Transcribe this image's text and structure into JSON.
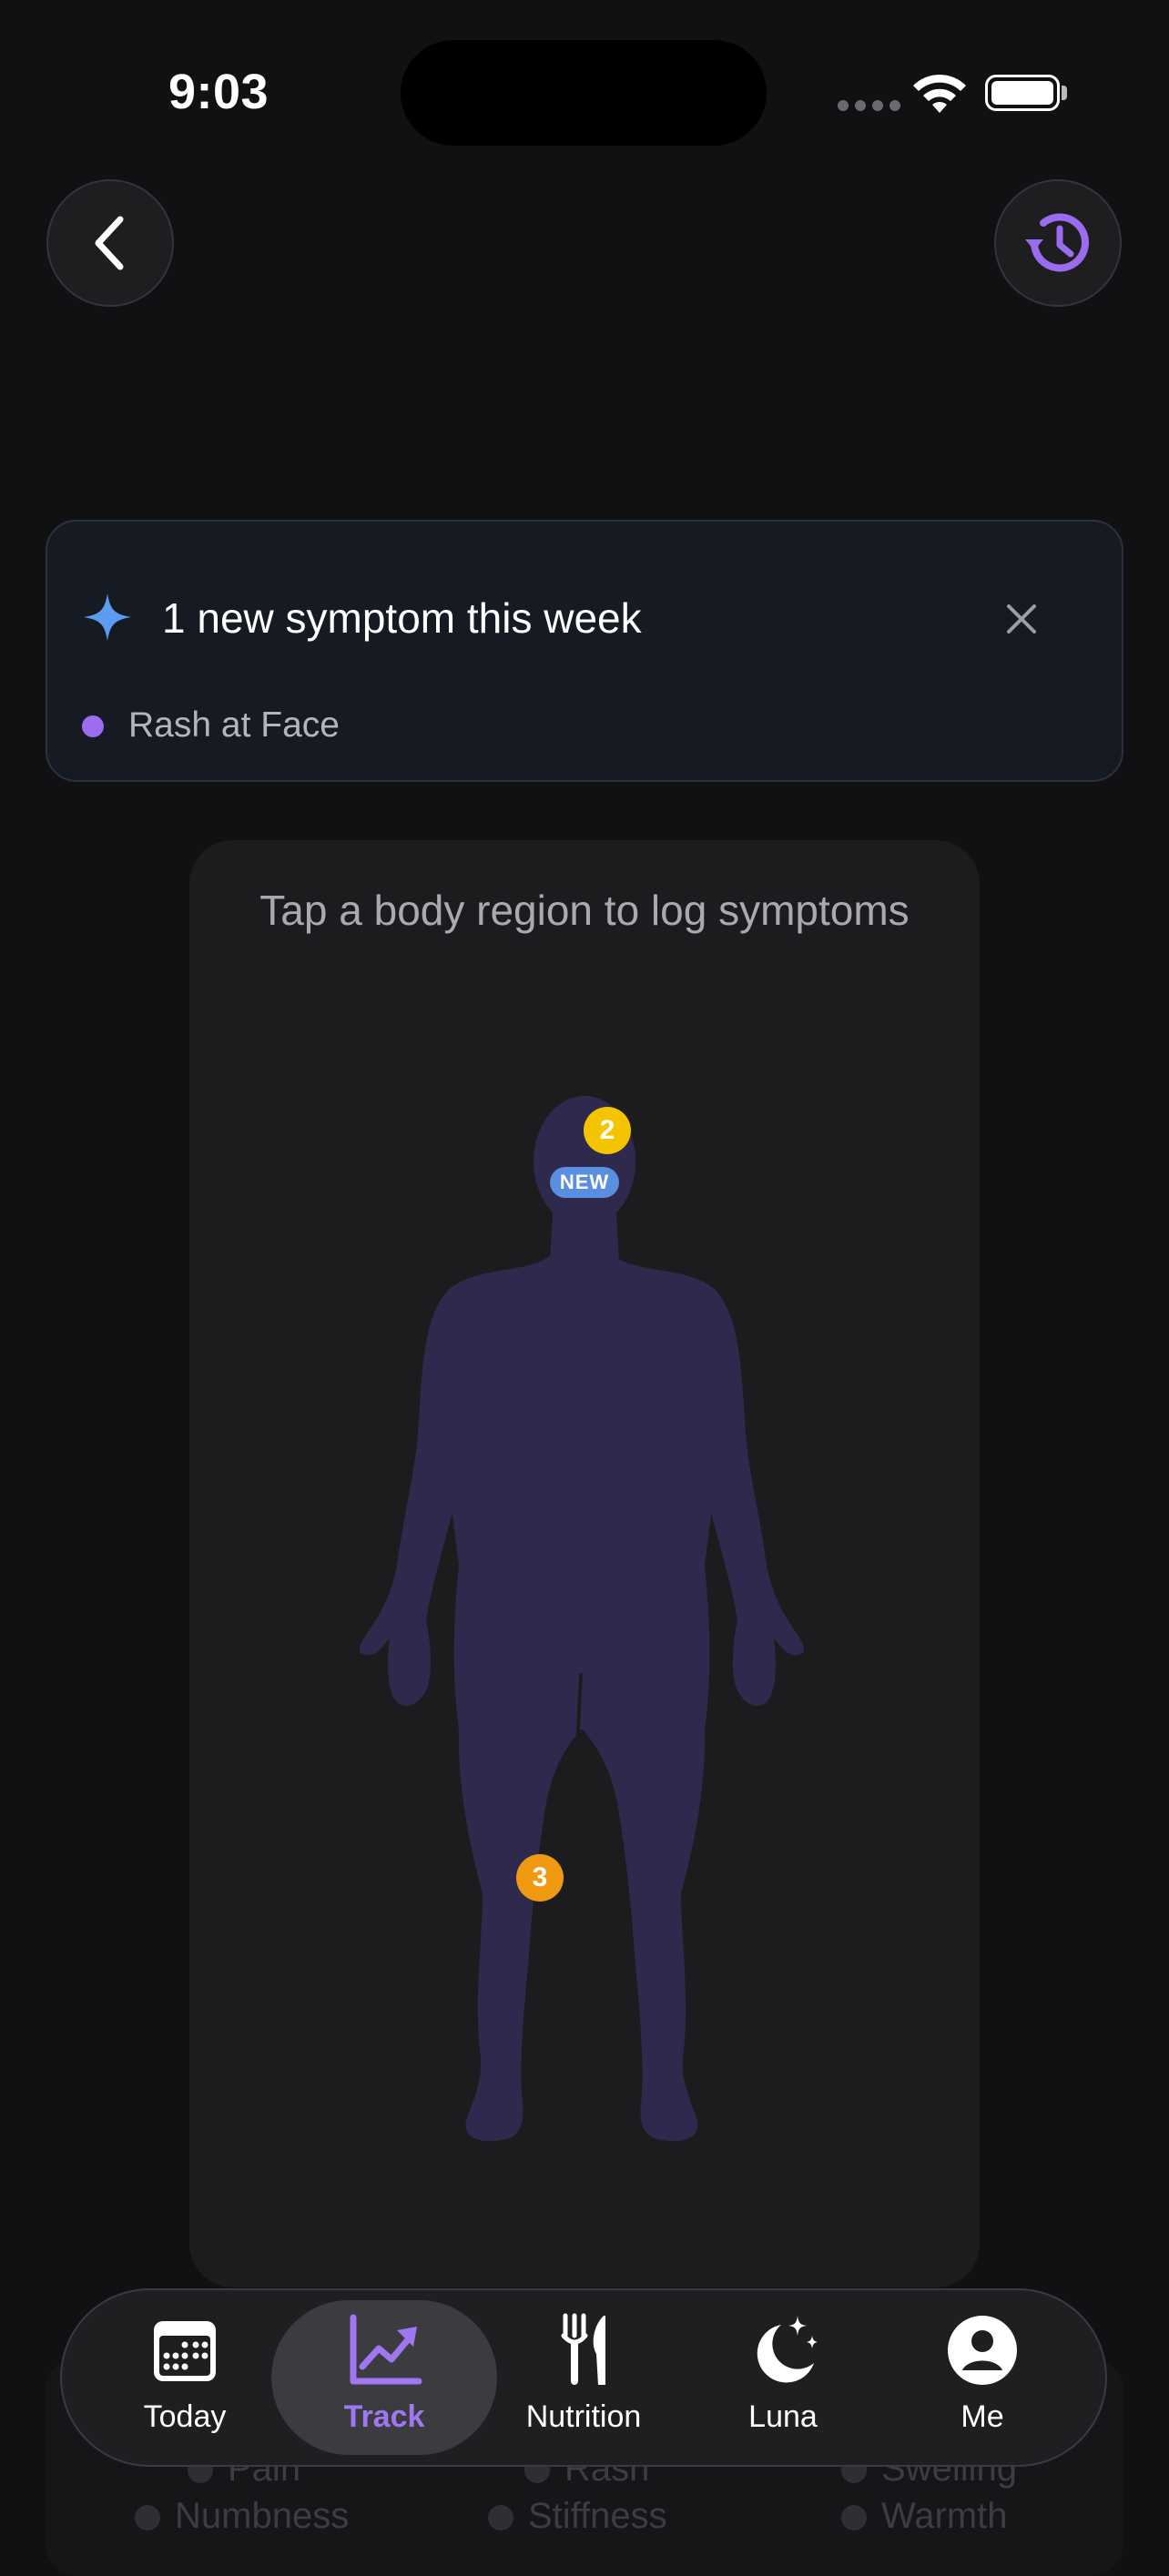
{
  "status_bar": {
    "time": "9:03"
  },
  "header": {
    "back_icon": "chevron-left-icon",
    "history_icon": "history-clock-icon"
  },
  "banner": {
    "icon": "sparkle-icon",
    "title": "1 new symptom this week",
    "close_icon": "close-icon",
    "items": [
      {
        "label": "Rash at Face",
        "dot_color": "#9b6cf0"
      }
    ]
  },
  "body_map": {
    "hint": "Tap a body region to log symptoms",
    "figure_color": "#2f2a4d",
    "markers": [
      {
        "region": "Face",
        "count": "2",
        "color": "#f5c400",
        "tag": "NEW"
      },
      {
        "region": "Knee",
        "count": "3",
        "color": "#f09a12"
      }
    ]
  },
  "behind_legend": {
    "row1": [
      "Pain",
      "Rash",
      "Swelling"
    ],
    "row2": [
      "Numbness",
      "Stiffness",
      "Warmth"
    ]
  },
  "tab_bar": {
    "active": "Track",
    "accent": "#a077f0",
    "tabs": [
      {
        "label": "Today",
        "icon": "calendar-icon"
      },
      {
        "label": "Track",
        "icon": "trend-chart-icon"
      },
      {
        "label": "Nutrition",
        "icon": "fork-knife-icon"
      },
      {
        "label": "Luna",
        "icon": "moon-stars-icon"
      },
      {
        "label": "Me",
        "icon": "person-icon"
      }
    ]
  }
}
